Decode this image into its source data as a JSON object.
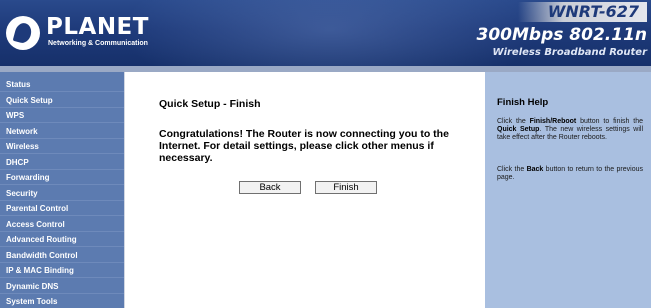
{
  "header": {
    "logo_text": "PLANET",
    "logo_sub": "Networking & Communication",
    "model": "WNRT-627",
    "tagline_speed": "300Mbps 802.11n",
    "tagline_product": "Wireless Broadband Router"
  },
  "sidebar": {
    "items": [
      {
        "label": "Status"
      },
      {
        "label": "Quick Setup"
      },
      {
        "label": "WPS"
      },
      {
        "label": "Network"
      },
      {
        "label": "Wireless"
      },
      {
        "label": "DHCP"
      },
      {
        "label": "Forwarding"
      },
      {
        "label": "Security"
      },
      {
        "label": "Parental Control"
      },
      {
        "label": "Access Control"
      },
      {
        "label": "Advanced Routing"
      },
      {
        "label": "Bandwidth Control"
      },
      {
        "label": "IP & MAC Binding"
      },
      {
        "label": "Dynamic DNS"
      },
      {
        "label": "System Tools"
      }
    ]
  },
  "main": {
    "title": "Quick Setup - Finish",
    "message": "Congratulations! The Router is now connecting you to the Internet. For detail settings, please click other menus if necessary.",
    "back_label": "Back",
    "finish_label": "Finish"
  },
  "help": {
    "title": "Finish Help",
    "p1_a": "Click the ",
    "p1_b": "Finish/Reboot",
    "p1_c": " button to finish the ",
    "p1_d": "Quick Setup",
    "p1_e": ". The new wireless settings will take effect after the Router reboots.",
    "p2_a": "Click the ",
    "p2_b": "Back",
    "p2_c": " button to return to the previous page."
  },
  "colors": {
    "header_bg": "#1e3a7a",
    "sidebar_bg": "#5c7bb0",
    "help_bg": "#a9bfe0"
  }
}
